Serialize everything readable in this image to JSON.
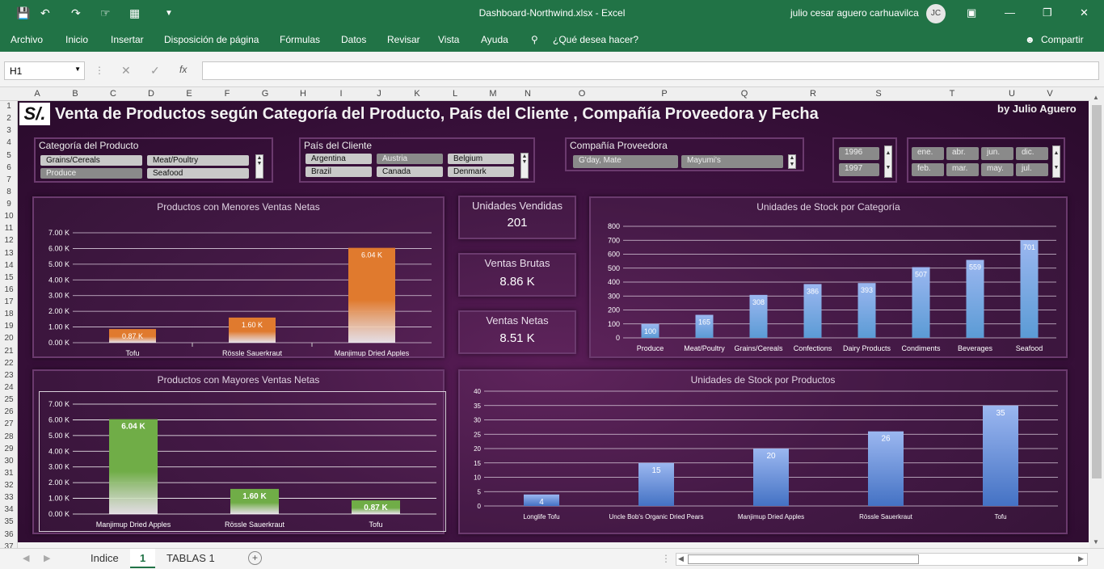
{
  "window": {
    "title": "Dashboard-Northwind.xlsx  -  Excel",
    "user": "julio cesar aguero carhuavilca",
    "initials": "JC"
  },
  "ribbon": {
    "tabs": [
      "Archivo",
      "Inicio",
      "Insertar",
      "Disposición de página",
      "Fórmulas",
      "Datos",
      "Revisar",
      "Vista",
      "Ayuda"
    ],
    "tell_me": "¿Qué desea hacer?",
    "share": "Compartir"
  },
  "formula": {
    "cell": "H1",
    "fx": "fx",
    "value": ""
  },
  "columns": [
    "A",
    "B",
    "C",
    "D",
    "E",
    "F",
    "G",
    "H",
    "I",
    "J",
    "K",
    "L",
    "M",
    "N",
    "O",
    "P",
    "Q",
    "R",
    "S",
    "T",
    "U",
    "V"
  ],
  "rows": [
    "1",
    "2",
    "3",
    "4",
    "5",
    "6",
    "7",
    "8",
    "9",
    "10",
    "11",
    "12",
    "13",
    "14",
    "15",
    "16",
    "17",
    "18",
    "19",
    "20",
    "21",
    "22",
    "23",
    "24",
    "25",
    "26",
    "27",
    "28",
    "29",
    "30",
    "31",
    "32",
    "33",
    "34",
    "35",
    "36",
    "37"
  ],
  "dashboard": {
    "logo": "S/.",
    "title": "Venta de Productos según Categoría del Producto, País del Cliente , Compañía Proveedora y Fecha",
    "byline": "by Julio  Aguero",
    "slicers": {
      "categoria": {
        "label": "Categoría del Producto",
        "items": [
          "Grains/Cereals",
          "Meat/Poultry",
          "Produce",
          "Seafood"
        ]
      },
      "pais": {
        "label": "País del Cliente",
        "items": [
          "Argentina",
          "Austria",
          "Belgium",
          "Brazil",
          "Canada",
          "Denmark"
        ]
      },
      "compania": {
        "label": "Compañía Proveedora",
        "items": [
          "G'day, Mate",
          "Mayumi's"
        ]
      },
      "anio": {
        "items": [
          "1996",
          "1997"
        ]
      },
      "mes": {
        "items": [
          "ene.",
          "abr.",
          "jun.",
          "dic.",
          "feb.",
          "mar.",
          "may.",
          "jul."
        ]
      }
    },
    "kpis": [
      {
        "label": "Unidades Vendidas",
        "value": "201"
      },
      {
        "label": "Ventas Brutas",
        "value": "8.86 K"
      },
      {
        "label": "Ventas Netas",
        "value": "8.51 K"
      }
    ]
  },
  "chart_data": [
    {
      "type": "bar",
      "title": "Productos con Menores Ventas Netas",
      "categories": [
        "Tofu",
        "Rössle Sauerkraut",
        "Manjimup Dried Apples"
      ],
      "values": [
        0.87,
        1.6,
        6.04
      ],
      "data_labels": [
        "0.87 K",
        "1.60 K",
        "6.04 K"
      ],
      "yticks": [
        "0.00 K",
        "1.00 K",
        "2.00 K",
        "3.00 K",
        "4.00 K",
        "5.00 K",
        "6.00 K",
        "7.00 K"
      ],
      "ylim": [
        0,
        7
      ],
      "color": "#e07a2e"
    },
    {
      "type": "bar",
      "title": "Unidades de Stock por Categoría",
      "categories": [
        "Produce",
        "Meat/Poultry",
        "Grains/Cereals",
        "Confections",
        "Dairy Products",
        "Condiments",
        "Beverages",
        "Seafood"
      ],
      "values": [
        100,
        165,
        308,
        386,
        393,
        507,
        559,
        701
      ],
      "yticks": [
        "0",
        "100",
        "200",
        "300",
        "400",
        "500",
        "600",
        "700",
        "800"
      ],
      "ylim": [
        0,
        800
      ],
      "color": "#5b9bd5"
    },
    {
      "type": "bar",
      "title": "Productos con Mayores Ventas Netas",
      "categories": [
        "Manjimup Dried Apples",
        "Rössle Sauerkraut",
        "Tofu"
      ],
      "values": [
        6.04,
        1.6,
        0.87
      ],
      "data_labels": [
        "6.04 K",
        "1.60 K",
        "0.87 K"
      ],
      "yticks": [
        "0.00 K",
        "1.00 K",
        "2.00 K",
        "3.00 K",
        "4.00 K",
        "5.00 K",
        "6.00 K",
        "7.00 K"
      ],
      "ylim": [
        0,
        7
      ],
      "color": "#70ad47"
    },
    {
      "type": "bar",
      "title": "Unidades de Stock por Productos",
      "categories": [
        "Longlife Tofu",
        "Uncle Bob's Organic Dried Pears",
        "Manjimup Dried Apples",
        "Rössle Sauerkraut",
        "Tofu"
      ],
      "values": [
        4,
        15,
        20,
        26,
        35
      ],
      "yticks": [
        "0",
        "5",
        "10",
        "15",
        "20",
        "25",
        "30",
        "35",
        "40"
      ],
      "ylim": [
        0,
        40
      ],
      "color": "#4472c4"
    }
  ],
  "sheets": {
    "tabs": [
      "Indice",
      "1",
      "TABLAS 1"
    ],
    "active": "1"
  },
  "colors": {
    "excel_green": "#217346",
    "dashboard_bg": "#3e1240"
  }
}
